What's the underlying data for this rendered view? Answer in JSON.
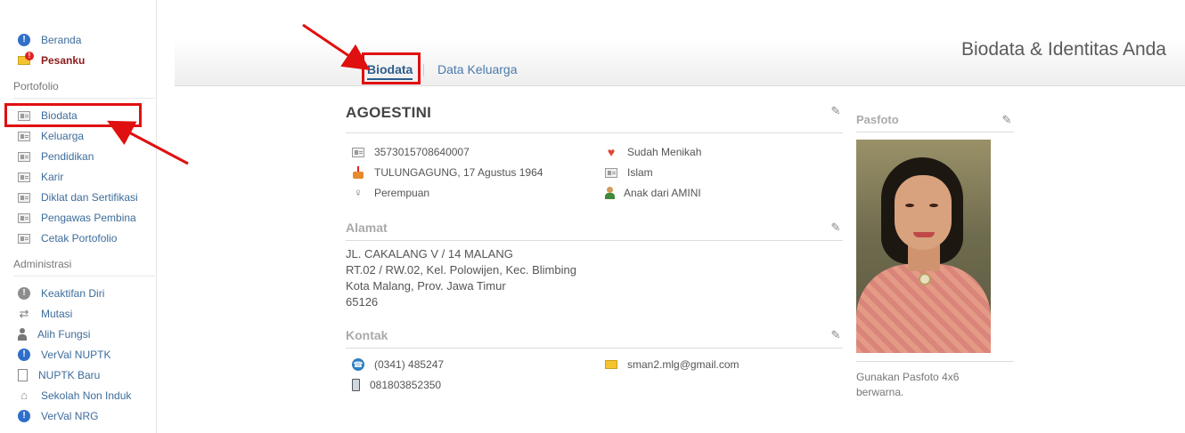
{
  "sidebar": {
    "top_items": [
      {
        "label": "Beranda",
        "icon": "info-icon"
      },
      {
        "label": "Pesanku",
        "icon": "mail-alert-icon"
      }
    ],
    "portofolio_heading": "Portofolio",
    "portofolio_items": [
      {
        "label": "Biodata",
        "icon": "id-card-icon"
      },
      {
        "label": "Keluarga",
        "icon": "id-card-icon"
      },
      {
        "label": "Pendidikan",
        "icon": "id-card-icon"
      },
      {
        "label": "Karir",
        "icon": "id-card-icon"
      },
      {
        "label": "Diklat dan Sertifikasi",
        "icon": "id-card-icon"
      },
      {
        "label": "Pengawas Pembina",
        "icon": "id-card-icon"
      },
      {
        "label": "Cetak Portofolio",
        "icon": "id-card-icon"
      }
    ],
    "administrasi_heading": "Administrasi",
    "administrasi_items": [
      {
        "label": "Keaktifan Diri",
        "icon": "grey-info-icon"
      },
      {
        "label": "Mutasi",
        "icon": "swap-icon"
      },
      {
        "label": "Alih Fungsi",
        "icon": "person-icon"
      },
      {
        "label": "VerVal NUPTK",
        "icon": "info-icon"
      },
      {
        "label": "NUPTK Baru",
        "icon": "document-icon"
      },
      {
        "label": "Sekolah Non Induk",
        "icon": "house-icon"
      },
      {
        "label": "VerVal NRG",
        "icon": "info-icon"
      }
    ]
  },
  "header": {
    "title": "Biodata & Identitas Anda",
    "tabs": [
      {
        "label": "Biodata",
        "active": true
      },
      {
        "label": "Data Keluarga",
        "active": false
      }
    ]
  },
  "profile": {
    "name": "AGOESTINI",
    "left": [
      {
        "value": "3573015708640007",
        "icon": "id-card-icon"
      },
      {
        "value": "TULUNGAGUNG, 17 Agustus 1964",
        "icon": "cake-icon"
      },
      {
        "value": "Perempuan",
        "icon": "female-icon"
      }
    ],
    "right": [
      {
        "value": "Sudah Menikah",
        "icon": "heart-icon"
      },
      {
        "value": "Islam",
        "icon": "id-card-icon"
      },
      {
        "value": "Anak dari AMINI",
        "icon": "child-icon"
      }
    ]
  },
  "alamat": {
    "title": "Alamat",
    "lines": [
      "JL. CAKALANG V / 14 MALANG",
      "RT.02 / RW.02, Kel. Polowijen, Kec. Blimbing",
      "Kota Malang, Prov. Jawa Timur",
      "65126"
    ]
  },
  "kontak": {
    "title": "Kontak",
    "phone": "(0341) 485247",
    "mobile": "081803852350",
    "email": "sman2.mlg@gmail.com"
  },
  "pasfoto": {
    "title": "Pasfoto",
    "note": "Gunakan Pasfoto 4x6 berwarna."
  },
  "colors": {
    "link": "#3d6c9b",
    "highlight": "#e01010",
    "active_tab": "#2d5d8d"
  }
}
